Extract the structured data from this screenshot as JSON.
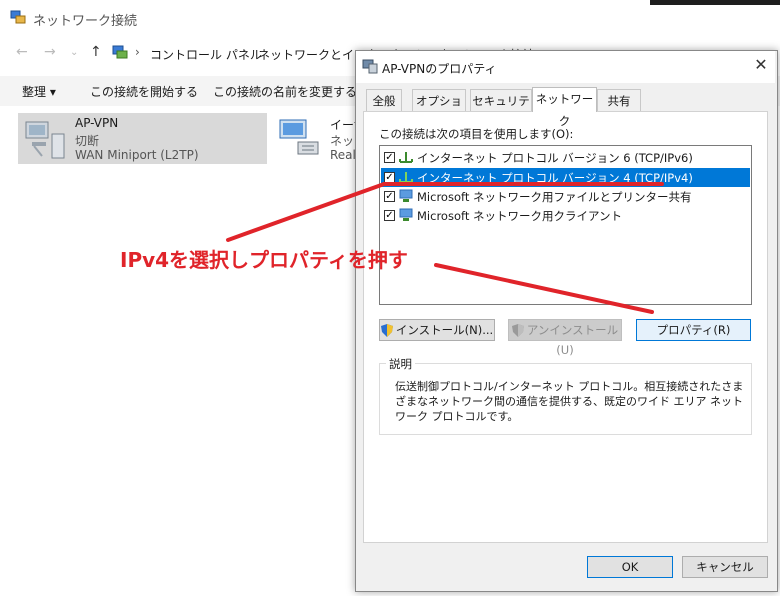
{
  "explorer": {
    "title": "ネットワーク接続",
    "address": {
      "crumb1": "コントロール パネル",
      "crumb2": "ネットワークとインターネット › ネットワーク接続"
    },
    "toolbar": {
      "organize": "整理 ▾",
      "start_connection": "この接続を開始する",
      "rename_connection": "この接続の名前を変更する"
    },
    "connections": [
      {
        "name": "AP-VPN",
        "status": "切断",
        "device": "WAN Miniport (L2TP)"
      },
      {
        "name": "イーサ",
        "status": "ネット",
        "device": "Realt"
      }
    ]
  },
  "dialog": {
    "title": "AP-VPNのプロパティ",
    "close_label": "✕",
    "tabs": [
      "全般",
      "オプション",
      "セキュリティ",
      "ネットワーク",
      "共有"
    ],
    "active_tab": "ネットワーク",
    "items_label": "この接続は次の項目を使用します(O):",
    "items": [
      {
        "label": "インターネット プロトコル バージョン 6 (TCP/IPv6)",
        "checked": true,
        "selected": false
      },
      {
        "label": "インターネット プロトコル バージョン 4 (TCP/IPv4)",
        "checked": true,
        "selected": true
      },
      {
        "label": "Microsoft ネットワーク用ファイルとプリンター共有",
        "checked": true,
        "selected": false
      },
      {
        "label": "Microsoft ネットワーク用クライアント",
        "checked": true,
        "selected": false
      }
    ],
    "buttons": {
      "install": "インストール(N)...",
      "uninstall": "アンインストール(U)",
      "properties": "プロパティ(R)",
      "ok": "OK",
      "cancel": "キャンセル"
    },
    "description": {
      "legend": "説明",
      "text": "伝送制御プロトコル/インターネット プロトコル。相互接続されたさまざまなネットワーク間の通信を提供する、既定のワイド エリア ネットワーク プロトコルです。"
    }
  },
  "annotation": {
    "text": "IPv4を選択しプロパティを押す",
    "color": "#e0242a"
  },
  "colors": {
    "selection": "#0078d7",
    "accent_border": "#0078d7"
  }
}
